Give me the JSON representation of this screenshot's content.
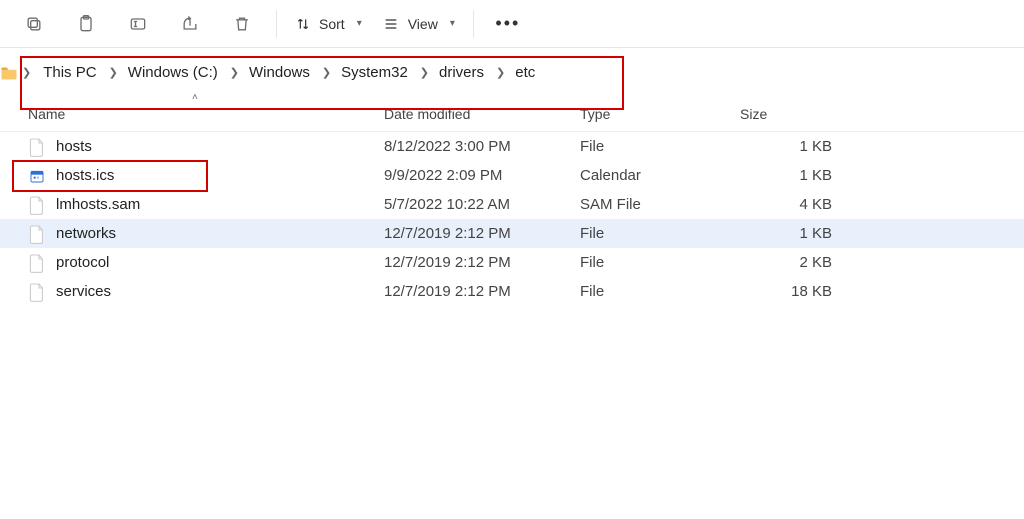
{
  "toolbar": {
    "sort_label": "Sort",
    "view_label": "View"
  },
  "breadcrumbs": {
    "items": [
      {
        "label": "This PC"
      },
      {
        "label": "Windows (C:)"
      },
      {
        "label": "Windows"
      },
      {
        "label": "System32"
      },
      {
        "label": "drivers"
      },
      {
        "label": "etc"
      }
    ]
  },
  "columns": {
    "name": "Name",
    "date": "Date modified",
    "type": "Type",
    "size": "Size"
  },
  "files": [
    {
      "name": "hosts",
      "date": "8/12/2022 3:00 PM",
      "type": "File",
      "size": "1 KB",
      "icon": "file",
      "selected": false
    },
    {
      "name": "hosts.ics",
      "date": "9/9/2022 2:09 PM",
      "type": "Calendar",
      "size": "1 KB",
      "icon": "calendar",
      "selected": false
    },
    {
      "name": "lmhosts.sam",
      "date": "5/7/2022 10:22 AM",
      "type": "SAM File",
      "size": "4 KB",
      "icon": "file",
      "selected": false
    },
    {
      "name": "networks",
      "date": "12/7/2019 2:12 PM",
      "type": "File",
      "size": "1 KB",
      "icon": "file",
      "selected": true
    },
    {
      "name": "protocol",
      "date": "12/7/2019 2:12 PM",
      "type": "File",
      "size": "2 KB",
      "icon": "file",
      "selected": false
    },
    {
      "name": "services",
      "date": "12/7/2019 2:12 PM",
      "type": "File",
      "size": "18 KB",
      "icon": "file",
      "selected": false
    }
  ]
}
